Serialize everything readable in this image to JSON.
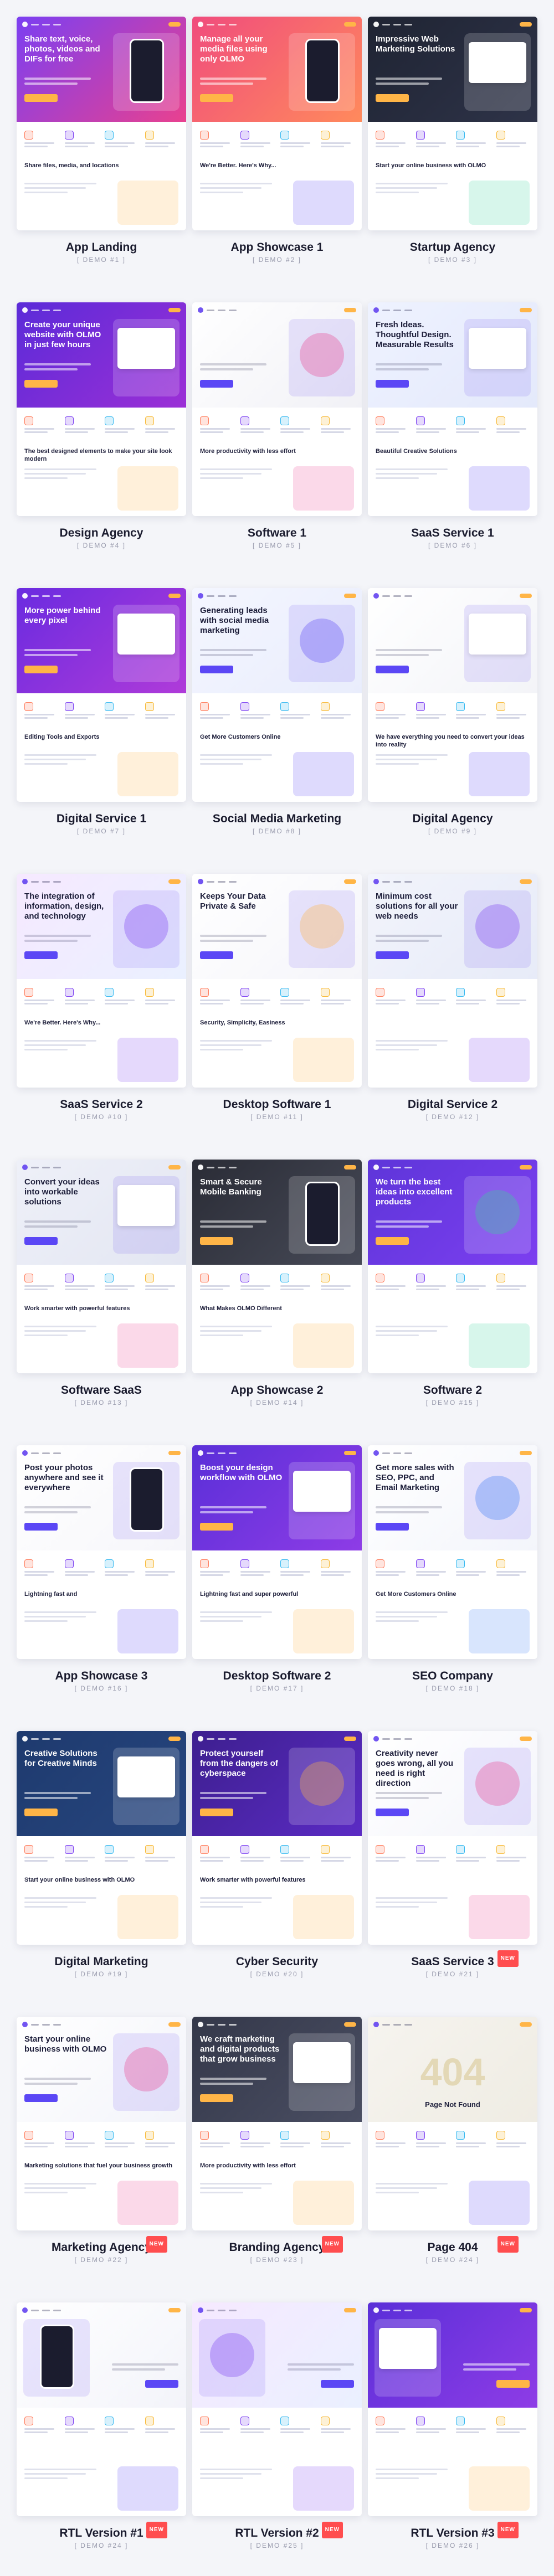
{
  "demos": [
    {
      "name": "App Landing",
      "demo": "[ DEMO #1 ]",
      "hero": "Share text, voice, photos, videos and DIFs for free",
      "section": "Share files, media, and locations",
      "bg": "linear-gradient(135deg,#7b3ff2,#e9418f)",
      "theme": "dark",
      "accent": "#ffb547",
      "art": "device",
      "isNew": false,
      "rtl": false
    },
    {
      "name": "App Showcase 1",
      "demo": "[ DEMO #2 ]",
      "hero": "Manage all your media files using only OLMO",
      "section": "We're Better. Here's Why...",
      "bg": "linear-gradient(135deg,#f04c7d,#ff8a5c)",
      "theme": "dark",
      "accent": "#5b47f5",
      "art": "device",
      "isNew": false,
      "rtl": false
    },
    {
      "name": "Startup Agency",
      "demo": "[ DEMO #3 ]",
      "hero": "Impressive Web Marketing Solutions",
      "section": "Start your online business with OLMO",
      "bg": "linear-gradient(135deg,#1f2433,#2e3348)",
      "theme": "dark",
      "accent": "#35d39b",
      "art": "panel",
      "isNew": false,
      "rtl": false
    },
    {
      "name": "Design Agency",
      "demo": "[ DEMO #4 ]",
      "hero": "Create your unique website with OLMO in just few hours",
      "section": "The best designed elements to make your site look modern",
      "bg": "linear-gradient(135deg,#5b2bd8,#9c2fd6)",
      "theme": "dark",
      "accent": "#ffb547",
      "art": "panel",
      "isNew": false,
      "rtl": false
    },
    {
      "name": "Software 1",
      "demo": "[ DEMO #5 ]",
      "hero": "",
      "section": "More productivity with less effort",
      "bg": "linear-gradient(135deg,#ffffff,#f1f1f6)",
      "theme": "light",
      "accent": "#e9418f",
      "art": "circle",
      "isNew": false,
      "rtl": false
    },
    {
      "name": "SaaS Service 1",
      "demo": "[ DEMO #6 ]",
      "hero": "Fresh Ideas. Thoughtful Design. Measurable Results",
      "section": "Beautiful Creative Solutions",
      "bg": "linear-gradient(135deg,#eef2ff,#e4e9fb)",
      "theme": "light",
      "accent": "#5b47f5",
      "art": "panel",
      "isNew": false,
      "rtl": false
    },
    {
      "name": "Digital Service 1",
      "demo": "[ DEMO #7 ]",
      "hero": "More power behind every pixel",
      "section": "Editing Tools and Exports",
      "bg": "linear-gradient(135deg,#6a2be0,#b03bd9)",
      "theme": "dark",
      "accent": "#ffb547",
      "art": "panel",
      "isNew": false,
      "rtl": false
    },
    {
      "name": "Social Media Marketing",
      "demo": "[ DEMO #8 ]",
      "hero": "Generating leads with social media marketing",
      "section": "Get More Customers Online",
      "bg": "linear-gradient(135deg,#f4f6ff,#e9edfc)",
      "theme": "light",
      "accent": "#5b47f5",
      "art": "circle",
      "isNew": false,
      "rtl": false
    },
    {
      "name": "Digital Agency",
      "demo": "[ DEMO #9 ]",
      "hero": "",
      "section": "We have everything you need to convert your ideas into reality",
      "bg": "linear-gradient(135deg,#ffffff,#f3f4f8)",
      "theme": "light",
      "accent": "#5b47f5",
      "art": "panel",
      "isNew": false,
      "rtl": false
    },
    {
      "name": "SaaS Service 2",
      "demo": "[ DEMO #10 ]",
      "hero": "The integration of information, design, and technology",
      "section": "We're Better. Here's Why...",
      "bg": "linear-gradient(135deg,#f6e9ff,#eaf0ff)",
      "theme": "light",
      "accent": "#7b3ff2",
      "art": "circle",
      "isNew": false,
      "rtl": false
    },
    {
      "name": "Desktop Software 1",
      "demo": "[ DEMO #11 ]",
      "hero": "Keeps Your Data Private & Safe",
      "section": "Security, Simplicity, Easiness",
      "bg": "linear-gradient(135deg,#ffffff,#f5f5fa)",
      "theme": "light",
      "accent": "#ffb547",
      "art": "circle",
      "isNew": false,
      "rtl": false
    },
    {
      "name": "Digital Service 2",
      "demo": "[ DEMO #12 ]",
      "hero": "Minimum cost solutions for all your web needs",
      "section": "",
      "bg": "linear-gradient(135deg,#f2f4fb,#e7ebf8)",
      "theme": "light",
      "accent": "#7b3ff2",
      "art": "circle",
      "isNew": false,
      "rtl": false
    },
    {
      "name": "Software SaaS",
      "demo": "[ DEMO #13 ]",
      "hero": "Convert your ideas into workable solutions",
      "section": "Work smarter with powerful features",
      "bg": "linear-gradient(135deg,#eef0f8,#e3e6f2)",
      "theme": "light",
      "accent": "#e9418f",
      "art": "panel",
      "isNew": false,
      "rtl": false
    },
    {
      "name": "App Showcase 2",
      "demo": "[ DEMO #14 ]",
      "hero": "Smart & Secure Mobile Banking",
      "section": "What Makes OLMO Different",
      "bg": "linear-gradient(135deg,#2a2c36,#474a57)",
      "theme": "dark",
      "accent": "#ffb547",
      "art": "device",
      "isNew": false,
      "rtl": false
    },
    {
      "name": "Software 2",
      "demo": "[ DEMO #15 ]",
      "hero": "We turn the best ideas into excellent products",
      "section": "",
      "bg": "linear-gradient(135deg,#5e35d9,#7c3ff0)",
      "theme": "dark",
      "accent": "#35d39b",
      "art": "circle",
      "isNew": false,
      "rtl": false
    },
    {
      "name": "App Showcase 3",
      "demo": "[ DEMO #16 ]",
      "hero": "Post your photos anywhere and see it everywhere",
      "section": "Lightning fast and",
      "bg": "linear-gradient(135deg,#ffffff,#f6f6fa)",
      "theme": "light",
      "accent": "#5b47f5",
      "art": "device",
      "isNew": false,
      "rtl": false
    },
    {
      "name": "Desktop Software 2",
      "demo": "[ DEMO #17 ]",
      "hero": "Boost your design workflow with OLMO",
      "section": "Lightning fast and super powerful",
      "bg": "linear-gradient(135deg,#5a2fd8,#8e3ce6)",
      "theme": "dark",
      "accent": "#ffb547",
      "art": "panel",
      "isNew": false,
      "rtl": false
    },
    {
      "name": "SEO Company",
      "demo": "[ DEMO #18 ]",
      "hero": "Get more sales with SEO, PPC, and Email Marketing",
      "section": "Get More Customers Online",
      "bg": "linear-gradient(135deg,#ffffff,#f3f5fb)",
      "theme": "light",
      "accent": "#3d7bf7",
      "art": "circle",
      "isNew": false,
      "rtl": false
    },
    {
      "name": "Digital Marketing",
      "demo": "[ DEMO #19 ]",
      "hero": "Creative Solutions for Creative Minds",
      "section": "Start your online business with OLMO",
      "bg": "linear-gradient(135deg,#1e3a6e,#27467f)",
      "theme": "dark",
      "accent": "#ffb547",
      "art": "panel",
      "isNew": false,
      "rtl": false
    },
    {
      "name": "Cyber Security",
      "demo": "[ DEMO #20 ]",
      "hero": "Protect yourself from the dangers of cyberspace",
      "section": "Work smarter with powerful features",
      "bg": "linear-gradient(135deg,#3d1f8f,#5b2bc4)",
      "theme": "dark",
      "accent": "#ffb547",
      "art": "circle",
      "isNew": false,
      "rtl": false
    },
    {
      "name": "SaaS Service 3",
      "demo": "[ DEMO #21 ]",
      "hero": "Creativity never goes wrong, all you need is right direction",
      "section": "",
      "bg": "linear-gradient(135deg,#ffffff,#f4f5fb)",
      "theme": "light",
      "accent": "#e9418f",
      "art": "circle",
      "isNew": true,
      "rtl": false
    },
    {
      "name": "Marketing Agency",
      "demo": "[ DEMO #22 ]",
      "hero": "Start your online business with OLMO",
      "section": "Marketing solutions that fuel your business growth",
      "bg": "linear-gradient(135deg,#ffffff,#f3f4fa)",
      "theme": "light",
      "accent": "#e9418f",
      "art": "circle",
      "isNew": true,
      "rtl": false
    },
    {
      "name": "Branding Agency",
      "demo": "[ DEMO #23 ]",
      "hero": "We craft marketing and digital products that grow business",
      "section": "More productivity with less effort",
      "bg": "linear-gradient(135deg,#34384a,#4a4e62)",
      "theme": "dark",
      "accent": "#ffb547",
      "art": "panel",
      "isNew": true,
      "rtl": false
    },
    {
      "name": "Page 404",
      "demo": "[ DEMO #24 ]",
      "hero": "Page Not Found",
      "section": "",
      "bg": "linear-gradient(135deg,#f6f4ef,#efece3)",
      "theme": "light",
      "accent": "#5b47f5",
      "art": "none",
      "isNew": true,
      "rtl": false
    },
    {
      "name": "RTL Version #1",
      "demo": "[ DEMO #24 ]",
      "hero": "",
      "section": "",
      "bg": "linear-gradient(135deg,#ffffff,#f3f4fa)",
      "theme": "light",
      "accent": "#5b47f5",
      "art": "device",
      "isNew": true,
      "rtl": true
    },
    {
      "name": "RTL Version #2",
      "demo": "[ DEMO #25 ]",
      "hero": "",
      "section": "",
      "bg": "linear-gradient(135deg,#f6e9ff,#eaf0ff)",
      "theme": "light",
      "accent": "#7b3ff2",
      "art": "circle",
      "isNew": true,
      "rtl": true
    },
    {
      "name": "RTL Version #3",
      "demo": "[ DEMO #26 ]",
      "hero": "",
      "section": "",
      "bg": "linear-gradient(135deg,#5a2fd8,#8e3ce6)",
      "theme": "dark",
      "accent": "#ffb547",
      "art": "panel",
      "isNew": true,
      "rtl": true
    }
  ],
  "new_label": "NEW",
  "code_404": "404"
}
